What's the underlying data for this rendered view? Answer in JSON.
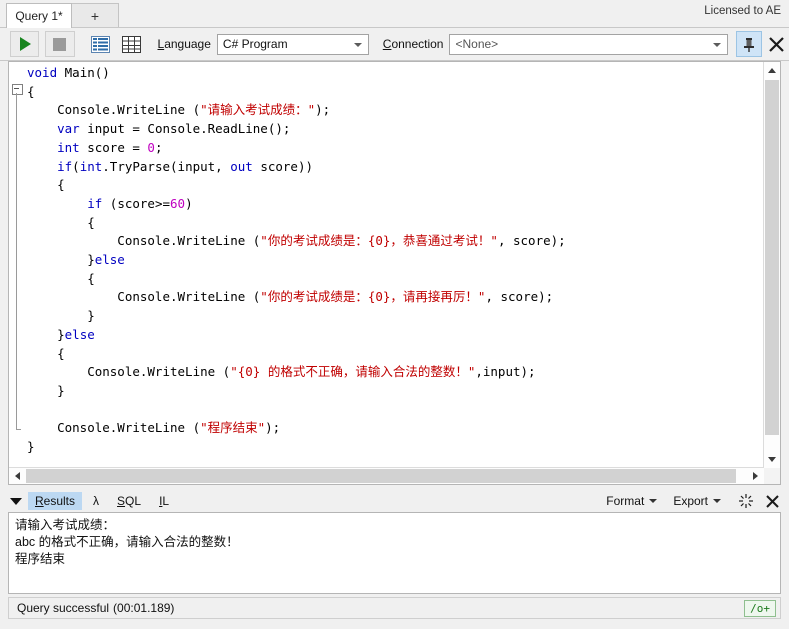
{
  "window": {
    "license": "Licensed to AE"
  },
  "tabs": {
    "items": [
      {
        "label": "Query 1*",
        "active": true
      },
      {
        "label": "+",
        "active": false
      }
    ]
  },
  "toolbar": {
    "run_icon": "play-icon",
    "stop_icon": "stop-icon",
    "results_grid_icon": "results-list-icon",
    "table_grid_icon": "table-grid-icon",
    "language_label": "Language",
    "language_underline": "L",
    "language_value": "C# Program",
    "connection_label": "Connection",
    "connection_underline": "C",
    "connection_value": "<None>",
    "pin_icon": "pin-icon",
    "close_icon": "close-icon"
  },
  "editor": {
    "lines": [
      [
        {
          "t": "void ",
          "c": "k"
        },
        {
          "t": "Main()",
          "c": "p"
        }
      ],
      [
        {
          "t": "{",
          "c": "br"
        }
      ],
      [
        {
          "t": "    Console.WriteLine (",
          "c": "p"
        },
        {
          "t": "\"请输入考试成绩：\"",
          "c": "s"
        },
        {
          "t": ");",
          "c": "p"
        }
      ],
      [
        {
          "t": "    ",
          "c": "p"
        },
        {
          "t": "var",
          "c": "k"
        },
        {
          "t": " input = Console.ReadLine();",
          "c": "p"
        }
      ],
      [
        {
          "t": "    ",
          "c": "p"
        },
        {
          "t": "int",
          "c": "k"
        },
        {
          "t": " score = ",
          "c": "p"
        },
        {
          "t": "0",
          "c": "n"
        },
        {
          "t": ";",
          "c": "p"
        }
      ],
      [
        {
          "t": "    ",
          "c": "p"
        },
        {
          "t": "if",
          "c": "k"
        },
        {
          "t": "(",
          "c": "p"
        },
        {
          "t": "int",
          "c": "k"
        },
        {
          "t": ".TryParse(input, ",
          "c": "p"
        },
        {
          "t": "out",
          "c": "k"
        },
        {
          "t": " score))",
          "c": "p"
        }
      ],
      [
        {
          "t": "    {",
          "c": "br"
        }
      ],
      [
        {
          "t": "        ",
          "c": "p"
        },
        {
          "t": "if",
          "c": "k"
        },
        {
          "t": " (score>=",
          "c": "p"
        },
        {
          "t": "60",
          "c": "n"
        },
        {
          "t": ")",
          "c": "p"
        }
      ],
      [
        {
          "t": "        {",
          "c": "br"
        }
      ],
      [
        {
          "t": "            Console.WriteLine (",
          "c": "p"
        },
        {
          "t": "\"你的考试成绩是：{0}，恭喜通过考试！\"",
          "c": "s"
        },
        {
          "t": ", score);",
          "c": "p"
        }
      ],
      [
        {
          "t": "        }",
          "c": "br"
        },
        {
          "t": "else",
          "c": "k"
        }
      ],
      [
        {
          "t": "        {",
          "c": "br"
        }
      ],
      [
        {
          "t": "            Console.WriteLine (",
          "c": "p"
        },
        {
          "t": "\"你的考试成绩是：{0}，请再接再厉！\"",
          "c": "s"
        },
        {
          "t": ", score);",
          "c": "p"
        }
      ],
      [
        {
          "t": "        }",
          "c": "br"
        }
      ],
      [
        {
          "t": "    }",
          "c": "br"
        },
        {
          "t": "else",
          "c": "k"
        }
      ],
      [
        {
          "t": "    {",
          "c": "br"
        }
      ],
      [
        {
          "t": "        Console.WriteLine (",
          "c": "p"
        },
        {
          "t": "\"{0} 的格式不正确，请输入合法的整数！\"",
          "c": "s"
        },
        {
          "t": ",input);",
          "c": "p"
        }
      ],
      [
        {
          "t": "    }",
          "c": "br"
        }
      ],
      [
        {
          "t": "",
          "c": "p"
        }
      ],
      [
        {
          "t": "    Console.WriteLine (",
          "c": "p"
        },
        {
          "t": "\"程序结束\"",
          "c": "s"
        },
        {
          "t": ");",
          "c": "p"
        }
      ],
      [
        {
          "t": "}",
          "c": "br"
        }
      ]
    ]
  },
  "results": {
    "expand_icon": "caret-down-icon",
    "tabs": [
      {
        "label": "Results",
        "underline": "R",
        "selected": true
      },
      {
        "label": "λ",
        "underline": "",
        "selected": false
      },
      {
        "label": "SQL",
        "underline": "S",
        "selected": false
      },
      {
        "label": "IL",
        "underline": "I",
        "selected": false
      }
    ],
    "format_label": "Format",
    "export_label": "Export",
    "sparkle_icon": "sparkle-icon",
    "close_icon": "close-icon",
    "output_lines": [
      "请输入考试成绩：",
      "abc 的格式不正确，请输入合法的整数！",
      "程序结束"
    ]
  },
  "status": {
    "message": "Query successful",
    "duration": "(00:01.189)",
    "badge": "/o+"
  }
}
